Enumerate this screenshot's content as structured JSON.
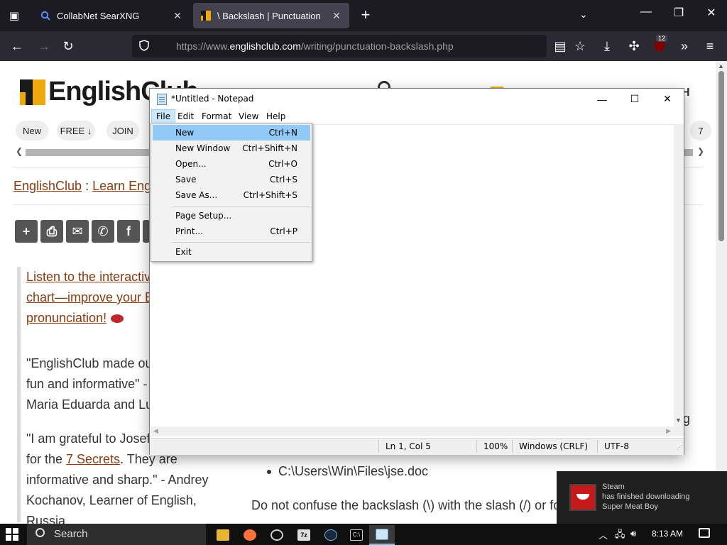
{
  "browser": {
    "tabs": [
      {
        "title": "CollabNet SearXNG",
        "icon": "search-icon",
        "active": false
      },
      {
        "title": "\\ Backslash | Punctuation",
        "icon": "englishclub-icon",
        "active": true
      }
    ],
    "url_prefix": "https://www.",
    "url_domain": "englishclub.com",
    "url_path": "/writing/punctuation-backslash.php",
    "extension_badge": "12"
  },
  "page": {
    "logo_text": "EnglishClub",
    "header_right": "H",
    "pills": [
      "New",
      "FREE ↓",
      "JOIN"
    ],
    "pill_right": "7",
    "breadcrumb": {
      "home": "EnglishClub",
      "sep": " : ",
      "next": "Learn Eng"
    },
    "callout": [
      "Listen to the interactiv",
      "chart—improve your E",
      "pronunciation!"
    ],
    "quote1": [
      "\"EnglishClub made ou",
      "fun and informative\" -",
      "Maria Eduarda and Lu"
    ],
    "quote2": {
      "line1": "\"I am grateful to Josef",
      "line2_pre": "for the ",
      "line2_link": "7 Secrets",
      "line2_post": ". They are",
      "line3": "informative and sharp.\" - Andrey",
      "line4": "Kochanov, Learner of English,",
      "line5": "Russia"
    },
    "bullet": "C:\\Users\\Win\\Files\\jse.doc",
    "para": "Do not confuse the backslash (\\) with the slash (/) or fo",
    "stray": "g"
  },
  "notepad": {
    "title": "*Untitled - Notepad",
    "menus": [
      "File",
      "Edit",
      "Format",
      "View",
      "Help"
    ],
    "file_menu": [
      {
        "label": "New",
        "shortcut": "Ctrl+N"
      },
      {
        "label": "New Window",
        "shortcut": "Ctrl+Shift+N"
      },
      {
        "label": "Open...",
        "shortcut": "Ctrl+O"
      },
      {
        "label": "Save",
        "shortcut": "Ctrl+S"
      },
      {
        "label": "Save As...",
        "shortcut": "Ctrl+Shift+S"
      },
      {
        "label": "Page Setup...",
        "shortcut": ""
      },
      {
        "label": "Print...",
        "shortcut": "Ctrl+P"
      },
      {
        "label": "Exit",
        "shortcut": ""
      }
    ],
    "status": {
      "position": "Ln 1, Col 5",
      "zoom": "100%",
      "line_ending": "Windows (CRLF)",
      "encoding": "UTF-8"
    }
  },
  "toast": {
    "app": "Steam",
    "line1": "has finished downloading",
    "line2": "Super Meat Boy"
  },
  "taskbar": {
    "search_label": "Search",
    "time": "8:13 AM"
  }
}
